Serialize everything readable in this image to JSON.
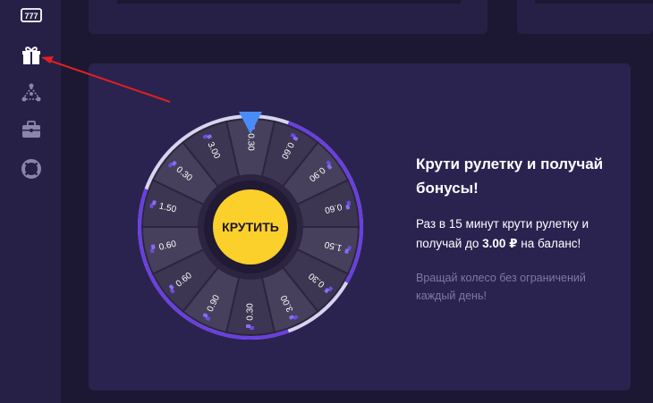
{
  "sidebar": {
    "items": [
      {
        "icon": "slot-machine-icon",
        "name": "sidebar-item-slots"
      },
      {
        "icon": "gift-icon",
        "name": "sidebar-item-bonus"
      },
      {
        "icon": "network-icon",
        "name": "sidebar-item-referral"
      },
      {
        "icon": "briefcase-icon",
        "name": "sidebar-item-cases"
      },
      {
        "icon": "lifebuoy-icon",
        "name": "sidebar-item-support"
      }
    ],
    "slots_glyph": "777"
  },
  "wheel": {
    "spin_label": "КРУТИТЬ",
    "segments": [
      "0.30",
      "0.60",
      "0.90",
      "0.60",
      "1.50",
      "0.30",
      "3.00",
      "0.30",
      "0.90",
      "0.60",
      "0.60",
      "1.50",
      "0.30",
      "3.00"
    ],
    "colors": {
      "segment": "#46405c",
      "segment_alt": "#3c3652",
      "inner_ring": "#2c2440",
      "rim": "#d9d4ee",
      "rim_accent": "#6a3fe0",
      "pointer": "#4a8cf7",
      "button": "#fcd02a"
    }
  },
  "promo": {
    "title": "Крути рулетку и получай бонусы!",
    "desc_prefix": "Раз в 15 минут крути рулетку и получай до ",
    "amount": "3.00 ₽",
    "desc_suffix": " на баланс!",
    "note": "Вращай колесо без ограничений каждый день!"
  },
  "colors": {
    "background": "#1c1833",
    "sidebar": "#262046",
    "card": "#2a2350",
    "annotation_arrow": "#e02020"
  }
}
